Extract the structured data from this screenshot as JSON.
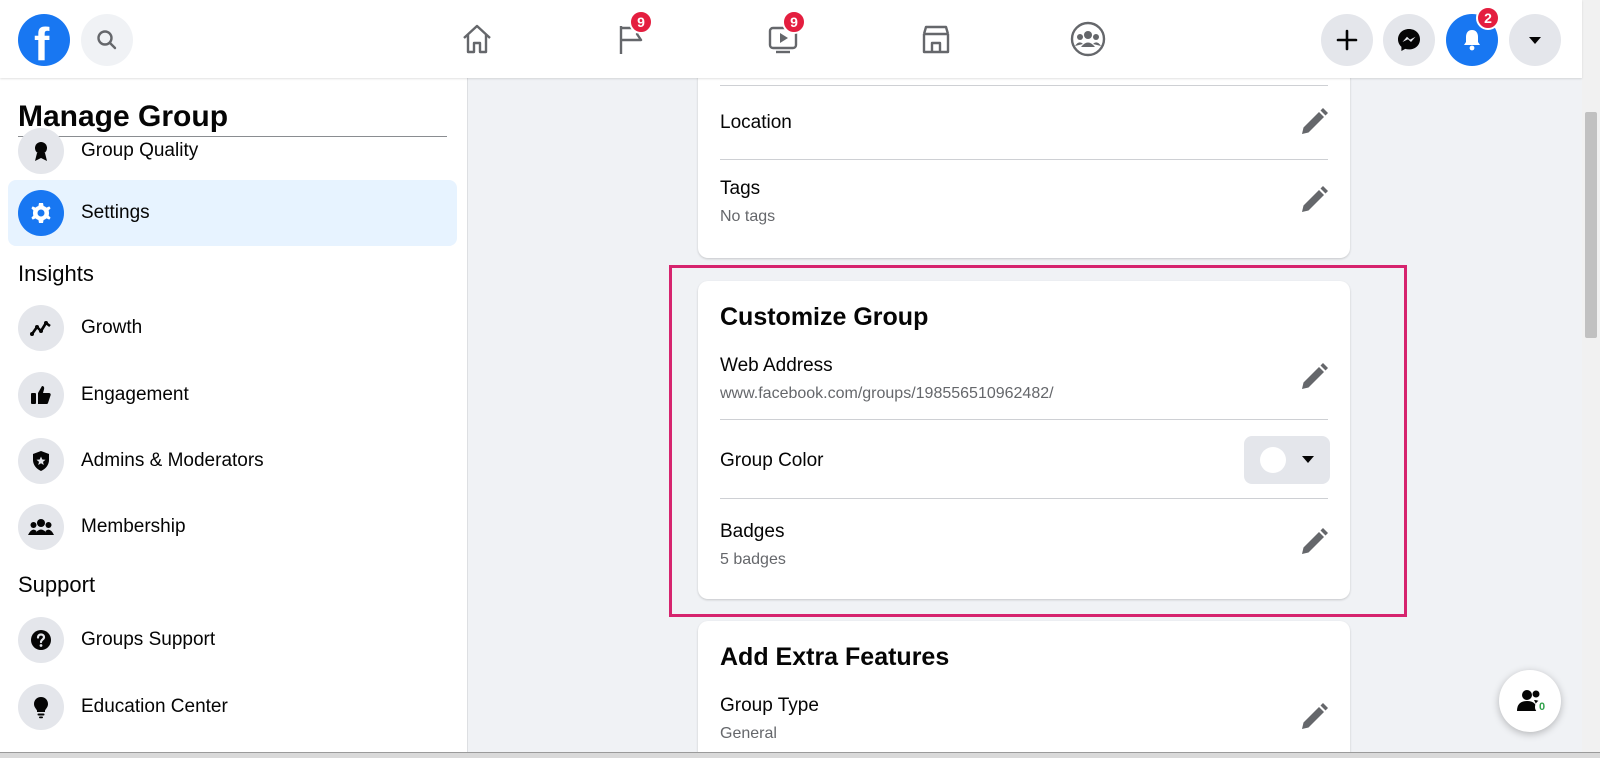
{
  "topbar": {
    "logo_letter": "f",
    "nav": {
      "pages_badge": "9",
      "watch_badge": "9"
    },
    "notifications_badge": "2"
  },
  "sidebar": {
    "title": "Manage Group",
    "items": [
      {
        "label": "Group Quality",
        "icon": "ribbon-icon"
      },
      {
        "label": "Settings",
        "icon": "gear-icon",
        "active": true
      }
    ],
    "insights": {
      "heading": "Insights",
      "items": [
        {
          "label": "Growth",
          "icon": "growth-icon"
        },
        {
          "label": "Engagement",
          "icon": "thumbs-up-icon"
        },
        {
          "label": "Admins & Moderators",
          "icon": "shield-star-icon"
        },
        {
          "label": "Membership",
          "icon": "people-icon"
        }
      ]
    },
    "support": {
      "heading": "Support",
      "items": [
        {
          "label": "Groups Support",
          "icon": "question-icon"
        },
        {
          "label": "Education Center",
          "icon": "lightbulb-icon"
        }
      ]
    }
  },
  "settings_card": {
    "location_label": "Location",
    "tags_label": "Tags",
    "tags_value": "No tags"
  },
  "customize_group": {
    "title": "Customize Group",
    "web_address_label": "Web Address",
    "web_address_value": "www.facebook.com/groups/198556510962482/",
    "group_color_label": "Group Color",
    "group_color_value": "#ffffff",
    "badges_label": "Badges",
    "badges_value": "5 badges"
  },
  "extra_features": {
    "title": "Add Extra Features",
    "group_type_label": "Group Type",
    "group_type_value": "General"
  },
  "chat_fab": {
    "count": "0"
  },
  "colors": {
    "accent": "#1877f2",
    "badge": "#e41e3f",
    "highlight": "#d6246e"
  }
}
